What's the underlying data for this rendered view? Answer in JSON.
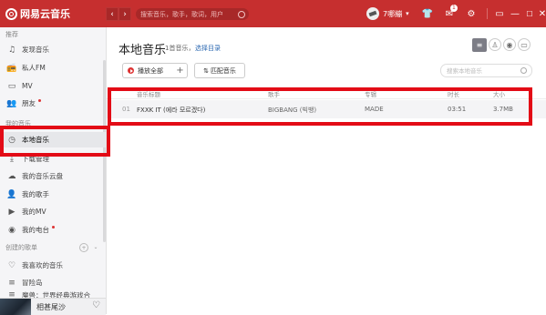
{
  "app": {
    "name": "网易云音乐",
    "brand_color": "#c62f2f"
  },
  "titlebar": {
    "search_placeholder": "搜索音乐，歌手，歌词，用户",
    "username": "7哪繃",
    "mail_badge": "1",
    "icons": [
      "back-icon",
      "forward-icon",
      "search-icon",
      "tshirt-icon",
      "mail-icon",
      "gear-icon",
      "mini-mode-icon",
      "minimize-icon",
      "maximize-icon",
      "close-icon"
    ]
  },
  "sidebar": {
    "recommend_title": "推荐",
    "recommend_items": [
      {
        "label": "发现音乐",
        "icon": "music-note-icon"
      },
      {
        "label": "私人FM",
        "icon": "radio-icon"
      },
      {
        "label": "MV",
        "icon": "video-icon"
      },
      {
        "label": "朋友",
        "icon": "friends-icon",
        "dot": true
      }
    ],
    "mymusic_title": "我的音乐",
    "mymusic_items": [
      {
        "label": "本地音乐",
        "icon": "clock-icon",
        "active": true
      },
      {
        "label": "下载管理",
        "icon": "download-icon"
      },
      {
        "label": "我的音乐云盘",
        "icon": "cloud-icon"
      },
      {
        "label": "我的歌手",
        "icon": "singer-icon"
      },
      {
        "label": "我的MV",
        "icon": "mv-icon"
      },
      {
        "label": "我的电台",
        "icon": "dj-icon",
        "dot": true
      }
    ],
    "playlist_title": "创建的歌单",
    "playlist_items": [
      {
        "label": "我喜欢的音乐",
        "icon": "heart-icon"
      },
      {
        "label": "冒险岛",
        "icon": "playlist-icon"
      },
      {
        "label": "魔兽：世界经典游戏合",
        "icon": "playlist-icon"
      }
    ],
    "now_playing": {
      "title": "相甚尾沙"
    }
  },
  "main": {
    "title": "本地音乐",
    "count": "1首音乐，",
    "choose_dir": "选择目录",
    "play_all": "播放全部",
    "plus": "+",
    "match": "匹配音乐",
    "search_placeholder": "搜索本地音乐",
    "columns": [
      "音乐标题",
      "歌手",
      "专辑",
      "时长",
      "大小"
    ],
    "rows": [
      {
        "index": "01",
        "title": "FXXK IT (에라 모르겠다)",
        "artist": "BIGBANG (빅뱅)",
        "album": "MADE",
        "duration": "03:51",
        "size": "3.7MB"
      }
    ]
  },
  "highlights": {
    "color": "#e30b16"
  }
}
